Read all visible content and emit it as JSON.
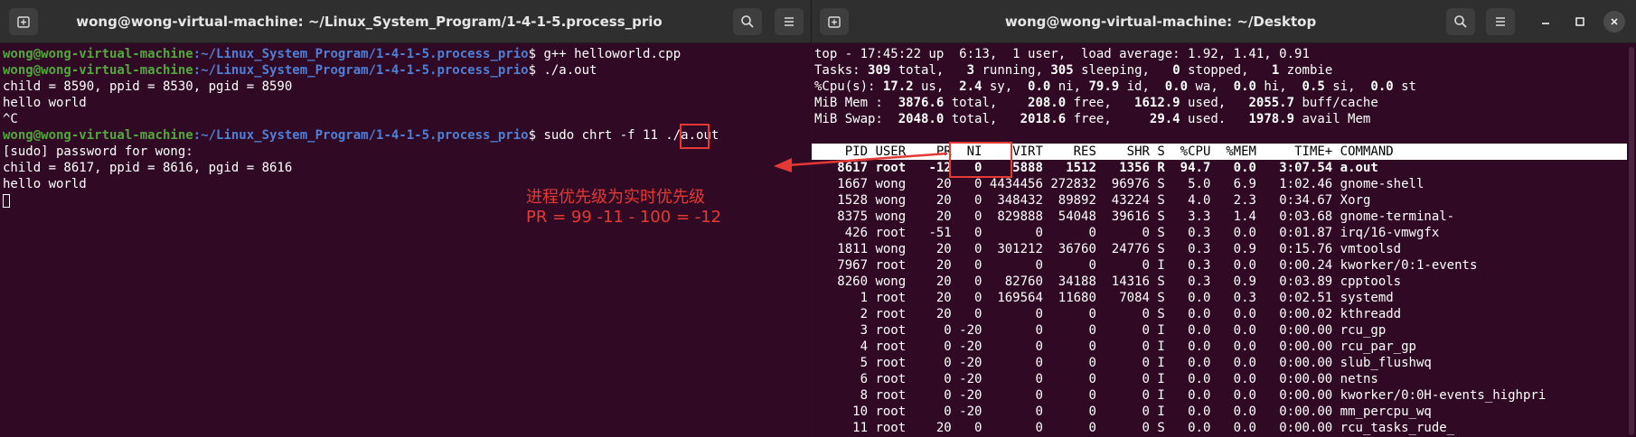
{
  "left_window": {
    "title": "wong@wong-virtual-machine: ~/Linux_System_Program/1-4-1-5.process_prio",
    "lines": [
      {
        "type": "prompt",
        "user": "wong@wong-virtual-machine",
        "path": "~/Linux_System_Program/1-4-1-5.process_prio",
        "cmd": "$ g++ helloworld.cpp"
      },
      {
        "type": "prompt",
        "user": "wong@wong-virtual-machine",
        "path": "~/Linux_System_Program/1-4-1-5.process_prio",
        "cmd": "$ ./a.out"
      },
      {
        "type": "out",
        "text": "child = 8590, ppid = 8530, pgid = 8590"
      },
      {
        "type": "out",
        "text": "hello world"
      },
      {
        "type": "out",
        "text": "^C"
      },
      {
        "type": "prompt",
        "user": "wong@wong-virtual-machine",
        "path": "~/Linux_System_Program/1-4-1-5.process_prio",
        "cmd": "$ sudo chrt -f 11 ./a.out"
      },
      {
        "type": "out",
        "text": "[sudo] password for wong:"
      },
      {
        "type": "out",
        "text": "child = 8617, ppid = 8616, pgid = 8616"
      },
      {
        "type": "out",
        "text": "hello world"
      }
    ],
    "annotation": {
      "line1": "进程优先级为实时优先级",
      "line2": "PR = 99 -11 - 100 = -12"
    }
  },
  "right_window": {
    "title": "wong@wong-virtual-machine: ~/Desktop",
    "summary": [
      [
        {
          "t": "top - 17:45:22 up  6:13,  1 user,  load average: 1.92, 1.41, 0.91"
        }
      ],
      [
        {
          "t": "Tasks: "
        },
        {
          "t": "309",
          "b": true
        },
        {
          "t": " total,   "
        },
        {
          "t": "3",
          "b": true
        },
        {
          "t": " running, "
        },
        {
          "t": "305",
          "b": true
        },
        {
          "t": " sleeping,   "
        },
        {
          "t": "0",
          "b": true
        },
        {
          "t": " stopped,   "
        },
        {
          "t": "1",
          "b": true
        },
        {
          "t": " zombie"
        }
      ],
      [
        {
          "t": "%Cpu(s): "
        },
        {
          "t": "17.2",
          "b": true
        },
        {
          "t": " us,  "
        },
        {
          "t": "2.4",
          "b": true
        },
        {
          "t": " sy,  "
        },
        {
          "t": "0.0",
          "b": true
        },
        {
          "t": " ni, "
        },
        {
          "t": "79.9",
          "b": true
        },
        {
          "t": " id,  "
        },
        {
          "t": "0.0",
          "b": true
        },
        {
          "t": " wa,  "
        },
        {
          "t": "0.0",
          "b": true
        },
        {
          "t": " hi,  "
        },
        {
          "t": "0.5",
          "b": true
        },
        {
          "t": " si,  "
        },
        {
          "t": "0.0",
          "b": true
        },
        {
          "t": " st"
        }
      ],
      [
        {
          "t": "MiB Mem :  "
        },
        {
          "t": "3876.6",
          "b": true
        },
        {
          "t": " total,    "
        },
        {
          "t": "208.0",
          "b": true
        },
        {
          "t": " free,   "
        },
        {
          "t": "1612.9",
          "b": true
        },
        {
          "t": " used,   "
        },
        {
          "t": "2055.7",
          "b": true
        },
        {
          "t": " buff/cache"
        }
      ],
      [
        {
          "t": "MiB Swap:  "
        },
        {
          "t": "2048.0",
          "b": true
        },
        {
          "t": " total,   "
        },
        {
          "t": "2018.6",
          "b": true
        },
        {
          "t": " free,     "
        },
        {
          "t": "29.4",
          "b": true
        },
        {
          "t": " used.   "
        },
        {
          "t": "1978.9",
          "b": true
        },
        {
          "t": " avail Mem"
        }
      ]
    ],
    "header": [
      "PID",
      "USER",
      "PR",
      "NI",
      "VIRT",
      "RES",
      "SHR",
      "S",
      "%CPU",
      "%MEM",
      "TIME+",
      "COMMAND"
    ],
    "processes": [
      [
        "8617",
        "root",
        "-12",
        "0",
        "5888",
        "1512",
        "1356",
        "R",
        "94.7",
        "0.0",
        "3:07.54",
        "a.out"
      ],
      [
        "1667",
        "wong",
        "20",
        "0",
        "4434456",
        "272832",
        "96976",
        "S",
        "5.0",
        "6.9",
        "1:02.46",
        "gnome-shell"
      ],
      [
        "1528",
        "wong",
        "20",
        "0",
        "348432",
        "89892",
        "43224",
        "S",
        "4.0",
        "2.3",
        "0:34.67",
        "Xorg"
      ],
      [
        "8375",
        "wong",
        "20",
        "0",
        "829888",
        "54048",
        "39616",
        "S",
        "3.3",
        "1.4",
        "0:03.68",
        "gnome-terminal-"
      ],
      [
        "426",
        "root",
        "-51",
        "0",
        "0",
        "0",
        "0",
        "S",
        "0.3",
        "0.0",
        "0:01.87",
        "irq/16-vmwgfx"
      ],
      [
        "1811",
        "wong",
        "20",
        "0",
        "301212",
        "36760",
        "24776",
        "S",
        "0.3",
        "0.9",
        "0:15.76",
        "vmtoolsd"
      ],
      [
        "7967",
        "root",
        "20",
        "0",
        "0",
        "0",
        "0",
        "I",
        "0.3",
        "0.0",
        "0:00.24",
        "kworker/0:1-events"
      ],
      [
        "8260",
        "wong",
        "20",
        "0",
        "82760",
        "34188",
        "14316",
        "S",
        "0.3",
        "0.9",
        "0:03.89",
        "cpptools"
      ],
      [
        "1",
        "root",
        "20",
        "0",
        "169564",
        "11680",
        "7084",
        "S",
        "0.0",
        "0.3",
        "0:02.51",
        "systemd"
      ],
      [
        "2",
        "root",
        "20",
        "0",
        "0",
        "0",
        "0",
        "S",
        "0.0",
        "0.0",
        "0:00.02",
        "kthreadd"
      ],
      [
        "3",
        "root",
        "0",
        "-20",
        "0",
        "0",
        "0",
        "I",
        "0.0",
        "0.0",
        "0:00.00",
        "rcu_gp"
      ],
      [
        "4",
        "root",
        "0",
        "-20",
        "0",
        "0",
        "0",
        "I",
        "0.0",
        "0.0",
        "0:00.00",
        "rcu_par_gp"
      ],
      [
        "5",
        "root",
        "0",
        "-20",
        "0",
        "0",
        "0",
        "I",
        "0.0",
        "0.0",
        "0:00.00",
        "slub_flushwq"
      ],
      [
        "6",
        "root",
        "0",
        "-20",
        "0",
        "0",
        "0",
        "I",
        "0.0",
        "0.0",
        "0:00.00",
        "netns"
      ],
      [
        "8",
        "root",
        "0",
        "-20",
        "0",
        "0",
        "0",
        "I",
        "0.0",
        "0.0",
        "0:00.00",
        "kworker/0:0H-events_highpri"
      ],
      [
        "10",
        "root",
        "0",
        "-20",
        "0",
        "0",
        "0",
        "I",
        "0.0",
        "0.0",
        "0:00.00",
        "mm_percpu_wq"
      ],
      [
        "11",
        "root",
        "20",
        "0",
        "0",
        "0",
        "0",
        "S",
        "0.0",
        "0.0",
        "0:00.00",
        "rcu_tasks_rude_"
      ]
    ]
  },
  "colors": {
    "terminal_bg": "#300a24",
    "titlebar_bg": "#2f2f2f",
    "prompt_user": "#53a83d",
    "prompt_path": "#4f7fd6",
    "annotation_red": "#e53935"
  },
  "icons": [
    "new-tab-icon",
    "search-icon",
    "menu-icon",
    "minimize-icon",
    "maximize-icon",
    "close-icon"
  ]
}
